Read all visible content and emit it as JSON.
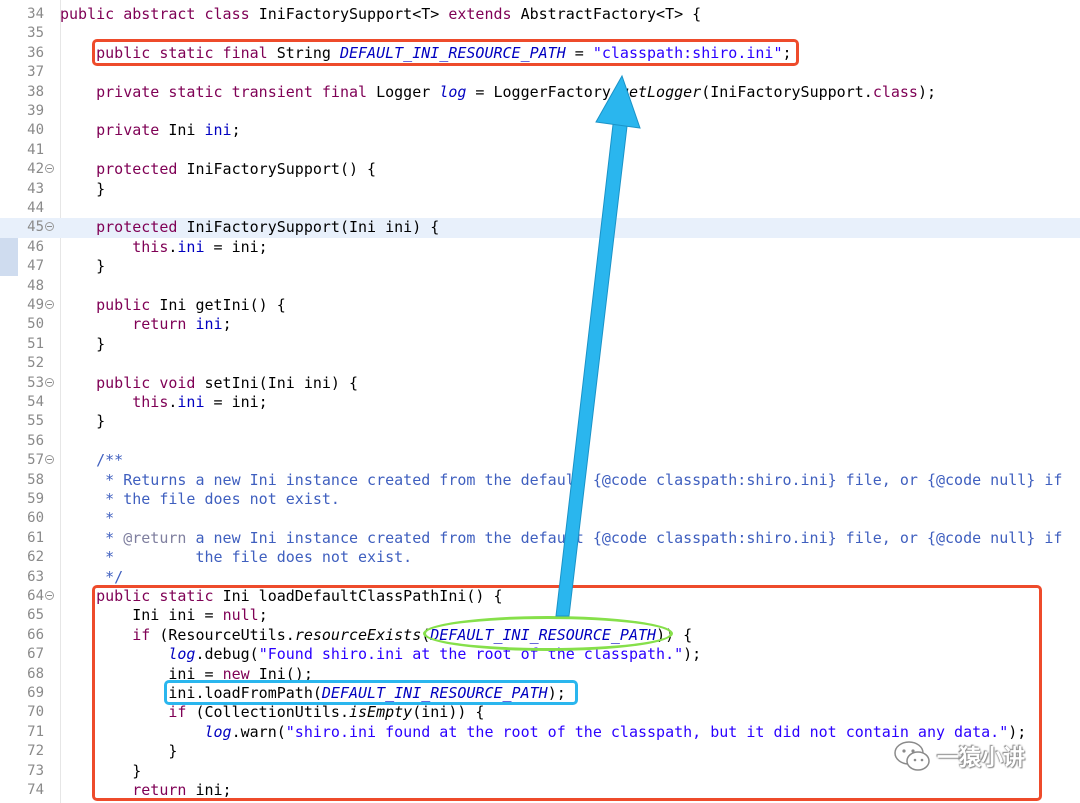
{
  "editor": {
    "lines": [
      {
        "n": "34",
        "tokens": [
          [
            "kw",
            "public abstract class "
          ],
          [
            "",
            "IniFactorySupport<T> "
          ],
          [
            "kw",
            "extends "
          ],
          [
            "",
            "AbstractFactory<T> {"
          ]
        ]
      },
      {
        "n": "35",
        "tokens": []
      },
      {
        "n": "36",
        "tokens": [
          [
            "",
            "    "
          ],
          [
            "kw",
            "public static final "
          ],
          [
            "",
            "String "
          ],
          [
            "sfld",
            "DEFAULT_INI_RESOURCE_PATH"
          ],
          [
            "",
            " = "
          ],
          [
            "str",
            "\"classpath:shiro.ini\""
          ],
          [
            "",
            ";"
          ]
        ]
      },
      {
        "n": "37",
        "tokens": []
      },
      {
        "n": "38",
        "tokens": [
          [
            "",
            "    "
          ],
          [
            "kw",
            "private static transient final "
          ],
          [
            "",
            "Logger "
          ],
          [
            "sfld",
            "log"
          ],
          [
            "",
            " = LoggerFactory."
          ],
          [
            "smeth",
            "getLogger"
          ],
          [
            "",
            "(IniFactorySupport."
          ],
          [
            "kw",
            "class"
          ],
          [
            "",
            ");"
          ]
        ]
      },
      {
        "n": "39",
        "tokens": []
      },
      {
        "n": "40",
        "tokens": [
          [
            "",
            "    "
          ],
          [
            "kw",
            "private "
          ],
          [
            "",
            "Ini "
          ],
          [
            "fld",
            "ini"
          ],
          [
            "",
            ";"
          ]
        ]
      },
      {
        "n": "41",
        "tokens": []
      },
      {
        "n": "42",
        "fold": true,
        "tokens": [
          [
            "",
            "    "
          ],
          [
            "kw",
            "protected "
          ],
          [
            "",
            "IniFactorySupport() {"
          ]
        ]
      },
      {
        "n": "43",
        "tokens": [
          [
            "",
            "    }"
          ]
        ]
      },
      {
        "n": "44",
        "tokens": []
      },
      {
        "n": "45",
        "fold": true,
        "hl": true,
        "tokens": [
          [
            "",
            "    "
          ],
          [
            "kw",
            "protected "
          ],
          [
            "",
            "IniFactorySupport(Ini ini) {"
          ]
        ]
      },
      {
        "n": "46",
        "tokens": [
          [
            "",
            "        "
          ],
          [
            "kw",
            "this"
          ],
          [
            "",
            "."
          ],
          [
            "fld",
            "ini"
          ],
          [
            "",
            " = ini;"
          ]
        ]
      },
      {
        "n": "47",
        "tokens": [
          [
            "",
            "    }"
          ]
        ]
      },
      {
        "n": "48",
        "tokens": []
      },
      {
        "n": "49",
        "fold": true,
        "tokens": [
          [
            "",
            "    "
          ],
          [
            "kw",
            "public "
          ],
          [
            "",
            "Ini getIni() {"
          ]
        ]
      },
      {
        "n": "50",
        "tokens": [
          [
            "",
            "        "
          ],
          [
            "kw",
            "return "
          ],
          [
            "fld",
            "ini"
          ],
          [
            "",
            ";"
          ]
        ]
      },
      {
        "n": "51",
        "tokens": [
          [
            "",
            "    }"
          ]
        ]
      },
      {
        "n": "52",
        "tokens": []
      },
      {
        "n": "53",
        "fold": true,
        "tokens": [
          [
            "",
            "    "
          ],
          [
            "kw",
            "public void "
          ],
          [
            "",
            "setIni(Ini ini) {"
          ]
        ]
      },
      {
        "n": "54",
        "tokens": [
          [
            "",
            "        "
          ],
          [
            "kw",
            "this"
          ],
          [
            "",
            "."
          ],
          [
            "fld",
            "ini"
          ],
          [
            "",
            " = ini;"
          ]
        ]
      },
      {
        "n": "55",
        "tokens": [
          [
            "",
            "    }"
          ]
        ]
      },
      {
        "n": "56",
        "tokens": []
      },
      {
        "n": "57",
        "fold": true,
        "tokens": [
          [
            "doc",
            "    /**"
          ]
        ]
      },
      {
        "n": "58",
        "tokens": [
          [
            "doc",
            "     * Returns a new Ini instance created from the default {@code classpath:shiro.ini} file, or {@code null} if"
          ]
        ]
      },
      {
        "n": "59",
        "tokens": [
          [
            "doc",
            "     * the file does not exist."
          ]
        ]
      },
      {
        "n": "60",
        "tokens": [
          [
            "doc",
            "     *"
          ]
        ]
      },
      {
        "n": "61",
        "tokens": [
          [
            "doc",
            "     * "
          ],
          [
            "dtag",
            "@return"
          ],
          [
            "doc",
            " a new Ini instance created from the default {@code classpath:shiro.ini} file, or {@code null} if"
          ]
        ]
      },
      {
        "n": "62",
        "tokens": [
          [
            "doc",
            "     *         the file does not exist."
          ]
        ]
      },
      {
        "n": "63",
        "tokens": [
          [
            "doc",
            "     */"
          ]
        ]
      },
      {
        "n": "64",
        "fold": true,
        "tokens": [
          [
            "",
            "    "
          ],
          [
            "kw",
            "public static "
          ],
          [
            "",
            "Ini loadDefaultClassPathIni() {"
          ]
        ]
      },
      {
        "n": "65",
        "tokens": [
          [
            "",
            "        Ini ini = "
          ],
          [
            "kw",
            "null"
          ],
          [
            "",
            ";"
          ]
        ]
      },
      {
        "n": "66",
        "tokens": [
          [
            "",
            "        "
          ],
          [
            "kw",
            "if "
          ],
          [
            "",
            "(ResourceUtils."
          ],
          [
            "smeth",
            "resourceExists"
          ],
          [
            "",
            "("
          ],
          [
            "sfld",
            "DEFAULT_INI_RESOURCE_PATH"
          ],
          [
            "",
            ")) {"
          ]
        ]
      },
      {
        "n": "67",
        "tokens": [
          [
            "",
            "            "
          ],
          [
            "sfld",
            "log"
          ],
          [
            "",
            ".debug("
          ],
          [
            "str",
            "\"Found shiro.ini at the root of the classpath.\""
          ],
          [
            "",
            ");"
          ]
        ]
      },
      {
        "n": "68",
        "tokens": [
          [
            "",
            "            ini = "
          ],
          [
            "kw",
            "new "
          ],
          [
            "",
            "Ini();"
          ]
        ]
      },
      {
        "n": "69",
        "tokens": [
          [
            "",
            "            ini.loadFromPath("
          ],
          [
            "sfld",
            "DEFAULT_INI_RESOURCE_PATH"
          ],
          [
            "",
            ");"
          ]
        ]
      },
      {
        "n": "70",
        "tokens": [
          [
            "",
            "            "
          ],
          [
            "kw",
            "if "
          ],
          [
            "",
            "(CollectionUtils."
          ],
          [
            "smeth",
            "isEmpty"
          ],
          [
            "",
            "(ini)) {"
          ]
        ]
      },
      {
        "n": "71",
        "tokens": [
          [
            "",
            "                "
          ],
          [
            "sfld",
            "log"
          ],
          [
            "",
            ".warn("
          ],
          [
            "str",
            "\"shiro.ini found at the root of the classpath, but it did not contain any data.\""
          ],
          [
            "",
            ");"
          ]
        ]
      },
      {
        "n": "72",
        "tokens": [
          [
            "",
            "            }"
          ]
        ]
      },
      {
        "n": "73",
        "tokens": [
          [
            "",
            "        }"
          ]
        ]
      },
      {
        "n": "74",
        "tokens": [
          [
            "",
            "        "
          ],
          [
            "kw",
            "return "
          ],
          [
            "",
            "ini;"
          ]
        ]
      }
    ]
  },
  "annotations": {
    "const_box_color": "#ee4b2b",
    "method_box_color": "#ee4b2b",
    "usage_oval_color": "#86e04a",
    "usage_box_color": "#2ab6ee",
    "arrow_color": "#2ab6ee"
  },
  "watermark": {
    "icon": "wechat-icon",
    "text": "一猿小讲"
  }
}
